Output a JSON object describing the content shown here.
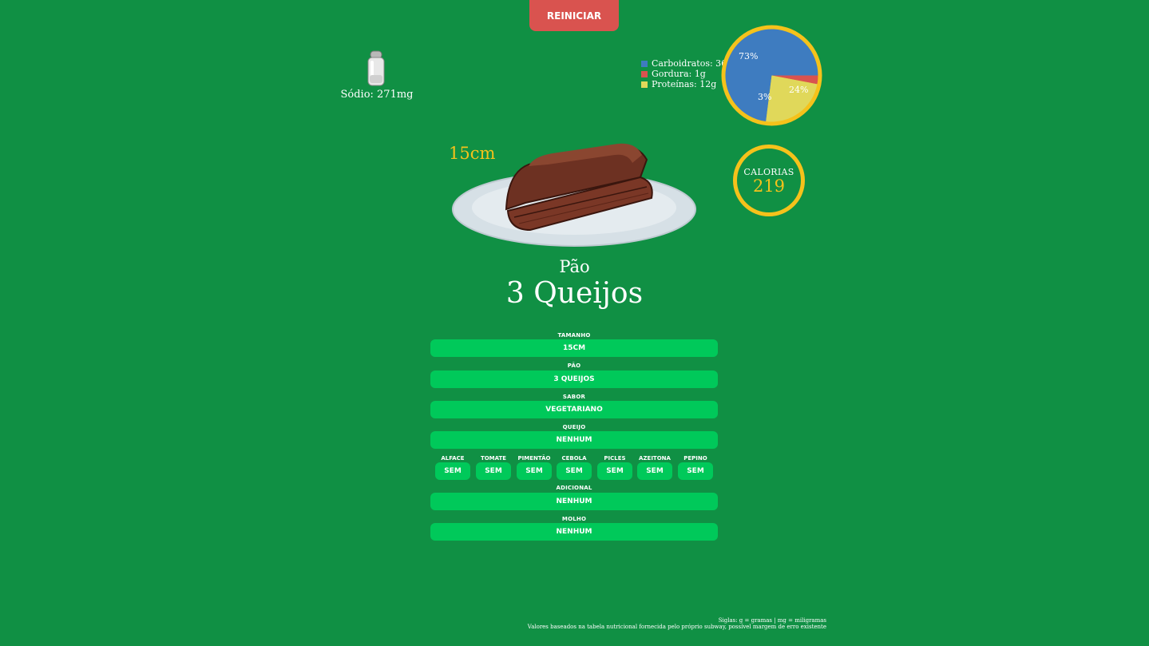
{
  "header": {
    "reset_label": "REINICIAR"
  },
  "sodium": {
    "label": "Sódio: 271mg",
    "icon": "salt-shaker-icon"
  },
  "macros": {
    "legend": [
      {
        "label": "Carboidratos: 36g",
        "color": "#3e7cc0"
      },
      {
        "label": "Gordura: 1g",
        "color": "#d9534f"
      },
      {
        "label": "Proteínas: 12g",
        "color": "#e0d85a"
      }
    ],
    "ring_color": "#f5c21b",
    "slice_labels": {
      "carbs": "73%",
      "fat": "3%",
      "protein": "24%"
    }
  },
  "chart_data": {
    "type": "pie",
    "categories": [
      "Carboidratos",
      "Gordura",
      "Proteínas"
    ],
    "values": [
      73,
      3,
      24
    ],
    "colors": [
      "#3e7cc0",
      "#d9534f",
      "#e0d85a"
    ],
    "title": ""
  },
  "calories": {
    "title": "CALORIAS",
    "value": "219"
  },
  "preview": {
    "size_label": "15cm",
    "bread_type_label": "Pão",
    "bread_name": "3 Queijos"
  },
  "form": {
    "size": {
      "label": "TAMANHO",
      "value": "15CM"
    },
    "bread": {
      "label": "PÃO",
      "value": "3 QUEIJOS"
    },
    "flavor": {
      "label": "SABOR",
      "value": "VEGETARIANO"
    },
    "cheese": {
      "label": "QUEIJO",
      "value": "NENHUM"
    },
    "veggies": [
      {
        "label": "ALFACE",
        "value": "SEM"
      },
      {
        "label": "TOMATE",
        "value": "SEM"
      },
      {
        "label": "PIMENTÃO",
        "value": "SEM"
      },
      {
        "label": "CEBOLA",
        "value": "SEM"
      },
      {
        "label": "PICLES",
        "value": "SEM"
      },
      {
        "label": "AZEITONA",
        "value": "SEM"
      },
      {
        "label": "PEPINO",
        "value": "SEM"
      }
    ],
    "extra": {
      "label": "ADICIONAL",
      "value": "NENHUM"
    },
    "sauce": {
      "label": "MOLHO",
      "value": "NENHUM"
    }
  },
  "footer": {
    "line1": "Siglas: g = gramas | mg = miligramas",
    "line2": "Valores baseados na tabela nutricional fornecida pelo próprio subway, possível margem de erro existente"
  }
}
